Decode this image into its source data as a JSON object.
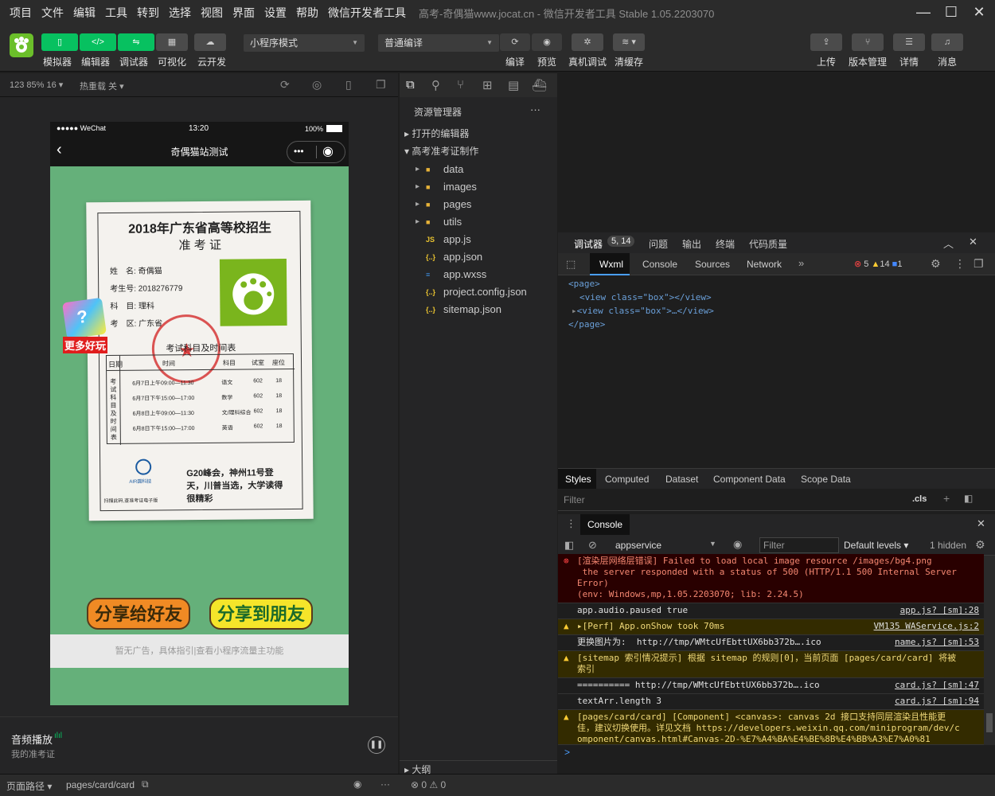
{
  "menu": {
    "items": [
      "项目",
      "文件",
      "编辑",
      "工具",
      "转到",
      "选择",
      "视图",
      "界面",
      "设置",
      "帮助",
      "微信开发者工具"
    ],
    "title": "高考-奇偶猫www.jocat.cn - 微信开发者工具 Stable 1.05.2203070"
  },
  "toolbar": {
    "left": [
      {
        "icon": "simulator",
        "label": "模拟器"
      },
      {
        "icon": "code",
        "label": "编辑器"
      },
      {
        "icon": "debug",
        "label": "调试器"
      },
      {
        "icon": "layout",
        "label": "可视化"
      },
      {
        "icon": "cloud",
        "label": "云开发"
      }
    ],
    "mode": "小程序模式",
    "compile": "普通编译",
    "mid": [
      {
        "label": "编译"
      },
      {
        "label": "预览"
      },
      {
        "label": "真机调试"
      },
      {
        "label": "清缓存"
      }
    ],
    "right": [
      {
        "label": "上传"
      },
      {
        "label": "版本管理"
      },
      {
        "label": "详情"
      },
      {
        "label": "消息"
      }
    ]
  },
  "simbar": {
    "zoom": "123 85% 16 ▾",
    "hotreload": "热重载 关 ▾"
  },
  "phone": {
    "signal": "●●●●● WeChat",
    "time": "13:20",
    "battery": "100%",
    "nav_title": "奇偶猫站测试",
    "cert": {
      "title": "2018年广东省高等校招生",
      "subtitle": "准 考 证",
      "name_label": "姓　名:",
      "name": "奇偶猫",
      "id_label": "考生号:",
      "id": "2018276779",
      "subject_label": "科　目:",
      "subject": "理科",
      "area_label": "考　区:",
      "area": "广东省",
      "schedule_title": "考试科目及时间表",
      "col_date": "日期",
      "col_time": "时间",
      "col_subject": "科目",
      "col_room": "试室",
      "col_seat": "座位",
      "side": "考试科目及时间表",
      "rows": [
        {
          "t": "6月7日上午09:00—11:30",
          "s": "语文",
          "r": "602",
          "seat": "18"
        },
        {
          "t": "6月7日下午15:00—17:00",
          "s": "数学",
          "r": "602",
          "seat": "18"
        },
        {
          "t": "6月8日上午09:00—11:30",
          "s": "文/理科综合",
          "r": "602",
          "seat": "18"
        },
        {
          "t": "6月8日下午15:00—17:00",
          "s": "英语",
          "r": "602",
          "seat": "18"
        }
      ],
      "logo": "AIR圆科技",
      "foot": "扫描此码,查准考证电子版",
      "news": "G20峰会，神州11号登天，川普当选，大学读得很精彩"
    },
    "more_fun": "更多好玩",
    "share_friend": "分享给好友",
    "share_moments": "分享到朋友圈",
    "ad": "暂无广告，具体指引|查看小程序流量主功能"
  },
  "audio": {
    "title": "音频播放",
    "subtitle": "我的准考证"
  },
  "bottom": {
    "path_label": "页面路径 ▾",
    "path": "pages/card/card",
    "errors": "0",
    "warnings": "0"
  },
  "explorer": {
    "title": "资源管理器",
    "more": "···",
    "open_editors": "打开的编辑器",
    "project": "高考准考证制作",
    "items": [
      {
        "name": "data",
        "type": "folder"
      },
      {
        "name": "images",
        "type": "folder"
      },
      {
        "name": "pages",
        "type": "folder"
      },
      {
        "name": "utils",
        "type": "folder"
      },
      {
        "name": "app.js",
        "type": "js"
      },
      {
        "name": "app.json",
        "type": "json"
      },
      {
        "name": "app.wxss",
        "type": "wxss"
      },
      {
        "name": "project.config.json",
        "type": "json"
      },
      {
        "name": "sitemap.json",
        "type": "json"
      }
    ],
    "outline": "大纲"
  },
  "devtools": {
    "tabs": [
      "调试器",
      "问题",
      "输出",
      "终端",
      "代码质量"
    ],
    "badge": "5, 14",
    "subtabs": [
      "Wxml",
      "Console",
      "Sources",
      "Network"
    ],
    "err_count": "5",
    "warn_count": "14",
    "info_count": "1",
    "wxml": [
      "<page>",
      "<view class=\"box\"></view>",
      "<view class=\"box\">…</view>",
      "</page>"
    ],
    "style_tabs": [
      "Styles",
      "Computed",
      "Dataset",
      "Component Data",
      "Scope Data"
    ],
    "filter": "Filter",
    "cls": ".cls",
    "console_tab": "Console",
    "context": "appservice",
    "console_filter": "Filter",
    "levels": "Default levels ▾",
    "hidden": "1 hidden",
    "logs": [
      {
        "kind": "err",
        "text": "[渲染层网络层错误] Failed to load local image resource /images/bg4.png\n the server responded with a status of 500 (HTTP/1.1 500 Internal Server Error)\n(env: Windows,mp,1.05.2203070; lib: 2.24.5)",
        "src": ""
      },
      {
        "kind": "norm",
        "text": "app.audio.paused true",
        "src": "app.js? [sm]:28"
      },
      {
        "kind": "warn",
        "text": "▸[Perf] App.onShow took 70ms",
        "src": "VM135 WAService.js:2"
      },
      {
        "kind": "norm",
        "text": "更换图片为:  http://tmp/WMtcUfEbttUX6bb372b….ico",
        "src": "name.js? [sm]:53"
      },
      {
        "kind": "warn",
        "text": "[sitemap 索引情况提示] 根据 sitemap 的规则[0]，当前页面 [pages/card/card] 将被索引",
        "src": ""
      },
      {
        "kind": "norm",
        "text": "========== http://tmp/WMtcUfEbttUX6bb372b….ico",
        "src": "card.js? [sm]:47"
      },
      {
        "kind": "norm",
        "text": "textArr.length 3",
        "src": "card.js? [sm]:94"
      },
      {
        "kind": "warn",
        "text": "[pages/card/card] [Component] <canvas>: canvas 2d 接口支持同层渲染且性能更佳，建议切换使用。详见文档 https://developers.weixin.qq.com/miniprogram/dev/component/canvas.html#Canvas-2D-%E7%A4%BA%E4%BE%8B%E4%BB%A3%E7%A0%81",
        "src": ""
      }
    ],
    "prompt": ">"
  }
}
